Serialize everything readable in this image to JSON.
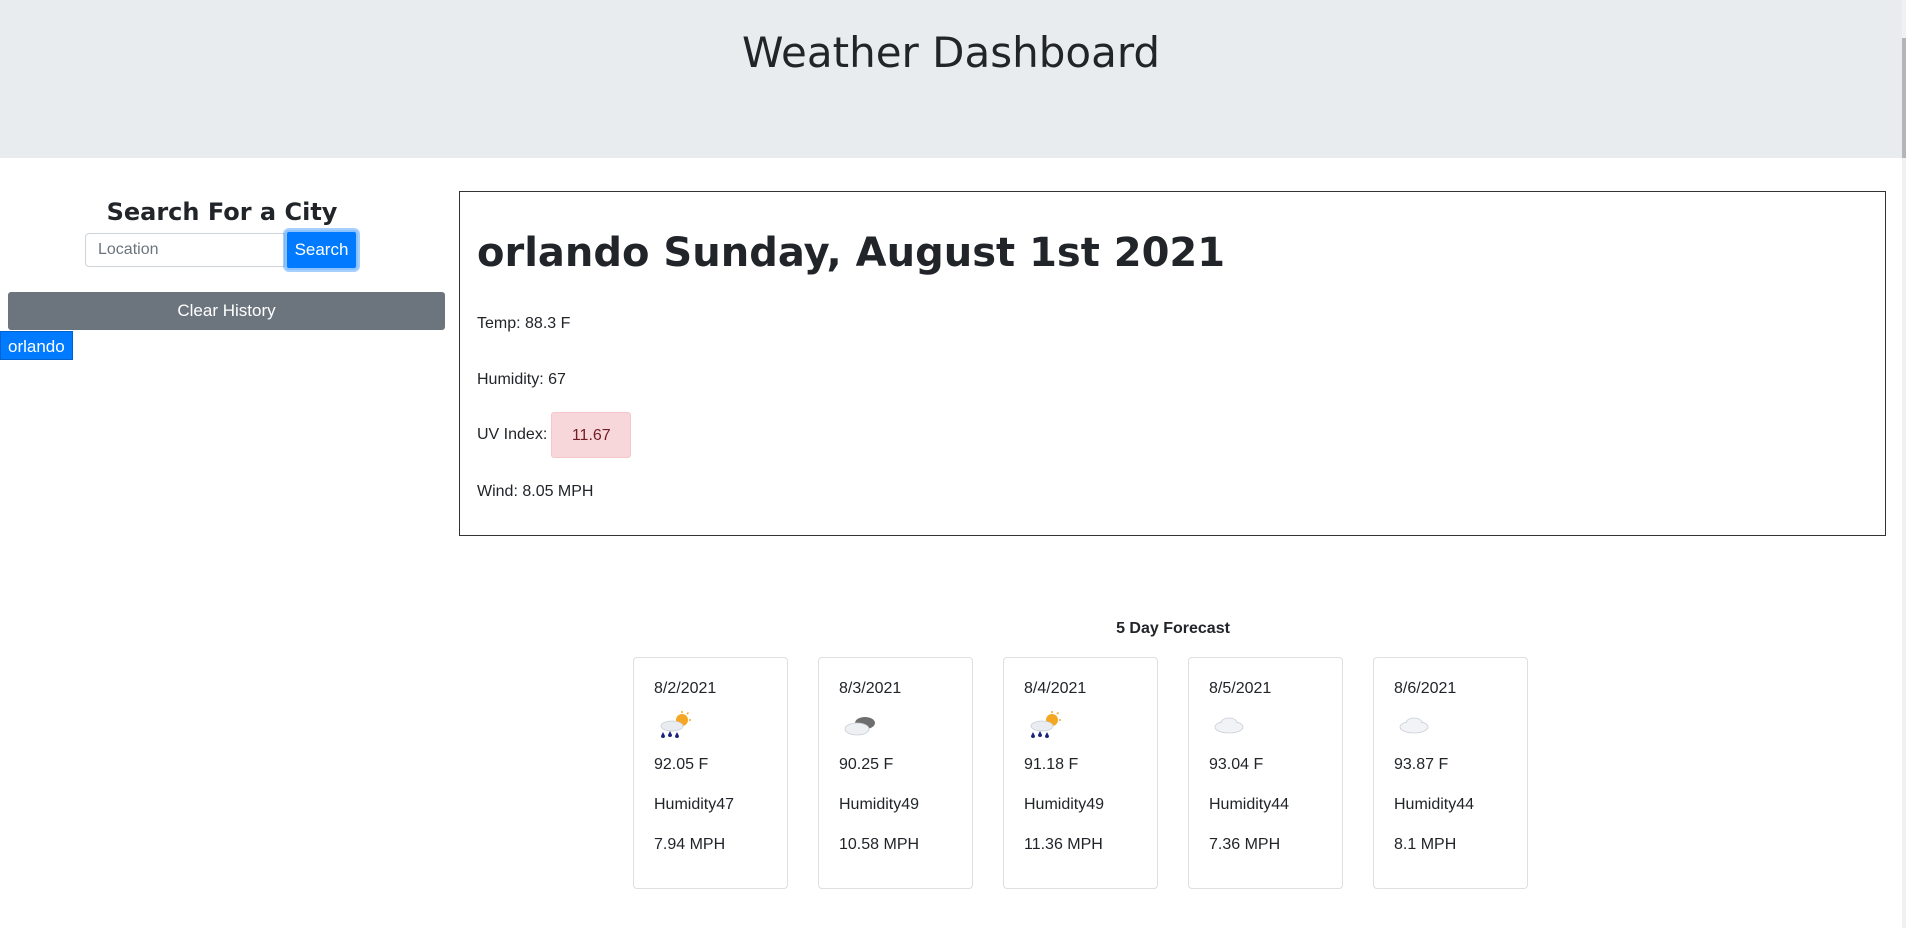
{
  "header": {
    "title": "Weather Dashboard"
  },
  "search": {
    "title": "Search For a City",
    "placeholder": "Location",
    "value": "",
    "button_label": "Search",
    "clear_label": "Clear History",
    "history": [
      "orlando"
    ]
  },
  "current": {
    "heading": "orlando Sunday, August 1st 2021",
    "temp": "Temp: 88.3 F",
    "humidity": "Humidity: 67",
    "uv_label": "UV Index:",
    "uv_value": "11.67",
    "wind": "Wind: 8.05 MPH"
  },
  "forecast": {
    "title": "5 Day Forecast",
    "days": [
      {
        "date": "8/2/2021",
        "icon": "light-rain-sun-icon",
        "temp": "92.05 F",
        "humidity": "Humidity47",
        "wind": "7.94 MPH"
      },
      {
        "date": "8/3/2021",
        "icon": "broken-clouds-icon",
        "temp": "90.25 F",
        "humidity": "Humidity49",
        "wind": "10.58 MPH"
      },
      {
        "date": "8/4/2021",
        "icon": "light-rain-sun-icon",
        "temp": "91.18 F",
        "humidity": "Humidity49",
        "wind": "11.36 MPH"
      },
      {
        "date": "8/5/2021",
        "icon": "cloud-icon",
        "temp": "93.04 F",
        "humidity": "Humidity44",
        "wind": "7.36 MPH"
      },
      {
        "date": "8/6/2021",
        "icon": "cloud-icon",
        "temp": "93.87 F",
        "humidity": "Humidity44",
        "wind": "8.1 MPH"
      }
    ]
  },
  "colors": {
    "primary": "#007bff",
    "secondary": "#6c757d",
    "uv_high_bg": "#f8d7da",
    "header_bg": "#e9ecef"
  }
}
